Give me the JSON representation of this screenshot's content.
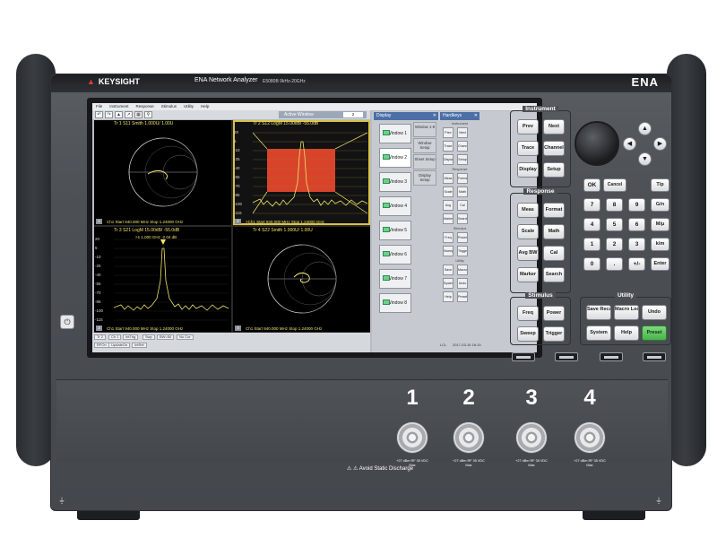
{
  "brand": {
    "logo": "KEYSIGHT",
    "model_name": "ENA Network Analyzer",
    "model_code": "E5080B 9kHz-20GHz",
    "family": "ENA"
  },
  "screen": {
    "menu": [
      "File",
      "Instrument",
      "Response",
      "Stimulus",
      "Utility",
      "Help"
    ],
    "active_window_label": "Active Window",
    "active_window_value": "2",
    "panes": [
      {
        "title": "Tr 1  S11 Smith 1.000U/  1.00U",
        "footer": "Ch1  Start  940.000 MHz        Stop  1.24000 GHz",
        "num": "1"
      },
      {
        "title": "Tr 2  S12 LogM 15.00dB/ -55.0dB",
        "footer": ">Ch1  Start  940.000 MHz        Stop  1.24000 GHz",
        "num": "2",
        "y_ticks": [
          "20",
          "5",
          "-10",
          "-25",
          "-40",
          "-55",
          "-70",
          "-85",
          "-100",
          "-115",
          "-130"
        ]
      },
      {
        "title": "Tr 3  S21 LogM 15.00dB/ -55.0dB",
        "footer": "Ch1  Start  940.000 MHz        Stop  1.24000 GHz",
        "num": "3",
        "marker": ">1   1.000 GHz        -2.04 dB",
        "y_ticks": [
          "20",
          "5",
          "-10",
          "-25",
          "-40",
          "-55",
          "-70",
          "-85",
          "-100",
          "-115",
          "-130"
        ]
      },
      {
        "title": "Tr 4  S22 Smith 1.000U/  1.00U",
        "footer": "Ch1  Start  940.000 MHz        Stop  1.24000 GHz",
        "num": "4"
      }
    ],
    "status_chips": [
      "Tr 2",
      "Ch 1",
      "IntTrig",
      "Swp",
      "BW=50",
      "No Cor",
      "RFOn",
      "UpdateOn",
      "IntRef"
    ],
    "datetime": "2017-03-16 18:15",
    "local": "LCL",
    "display_panel": {
      "title": "Display",
      "windows": [
        "Window 1",
        "Window 2",
        "Window 3",
        "Window 4",
        "Window 5",
        "Window 6",
        "Window 7",
        "Window 8"
      ],
      "extra_buttons": [
        "Window 1-8",
        "Window Setup",
        "Sheet Setup",
        "Display Setup"
      ]
    },
    "hardkeys_panel": {
      "title": "Hardkeys",
      "sections": [
        "Instrument",
        "Response",
        "Stimulus",
        "Utility"
      ],
      "keys": [
        "Prev",
        "Next",
        "Trace",
        "Channel",
        "Display",
        "Setup",
        "Meas",
        "Format",
        "Scale",
        "Math",
        "Avg BW",
        "Cal",
        "Marker",
        "Search",
        "Freq",
        "Power",
        "Sweep",
        "Trigger",
        "Save Recall",
        "Macro",
        "System",
        "Undo",
        "Help",
        "Preset"
      ]
    }
  },
  "front_panel": {
    "instrument": {
      "label": "Instrument",
      "keys": [
        "Prev",
        "Next",
        "Trace",
        "Channel",
        "Display",
        "Setup"
      ]
    },
    "response": {
      "label": "Response",
      "keys": [
        "Meas",
        "Format",
        "Scale",
        "Math",
        "Avg BW",
        "Cal",
        "Marker",
        "Search"
      ]
    },
    "stimulus": {
      "label": "Stimulus",
      "keys": [
        "Freq",
        "Power",
        "Sweep",
        "Trigger"
      ]
    },
    "utility": {
      "label": "Utility",
      "keys": [
        "Save Recall",
        "Macro Local",
        "Undo",
        "System",
        "Help",
        "Preset"
      ]
    },
    "numpad": [
      "OK",
      "Cancel",
      "7",
      "8",
      "9",
      "4",
      "5",
      "6",
      "1",
      "2",
      "3",
      "0",
      ".",
      "+/-"
    ],
    "units": [
      "T/p",
      "G/n",
      "M/μ",
      "k/m",
      "Enter"
    ],
    "arrows": [
      "▲",
      "◀",
      "▶",
      "▼"
    ]
  },
  "ports": [
    {
      "number": "1",
      "spec": "+27 dBm RF 35 VDC Max"
    },
    {
      "number": "2",
      "spec": "+27 dBm RF 35 VDC Max"
    },
    {
      "number": "3",
      "spec": "+27 dBm RF 35 VDC Max"
    },
    {
      "number": "4",
      "spec": "+27 dBm RF 35 VDC Max"
    }
  ],
  "warning": "⚠ ⚠ Avoid Static Discharge",
  "colors": {
    "trace": "#f0e36a",
    "accent_red": "#e03a3a",
    "preset_green": "#49b34b"
  }
}
